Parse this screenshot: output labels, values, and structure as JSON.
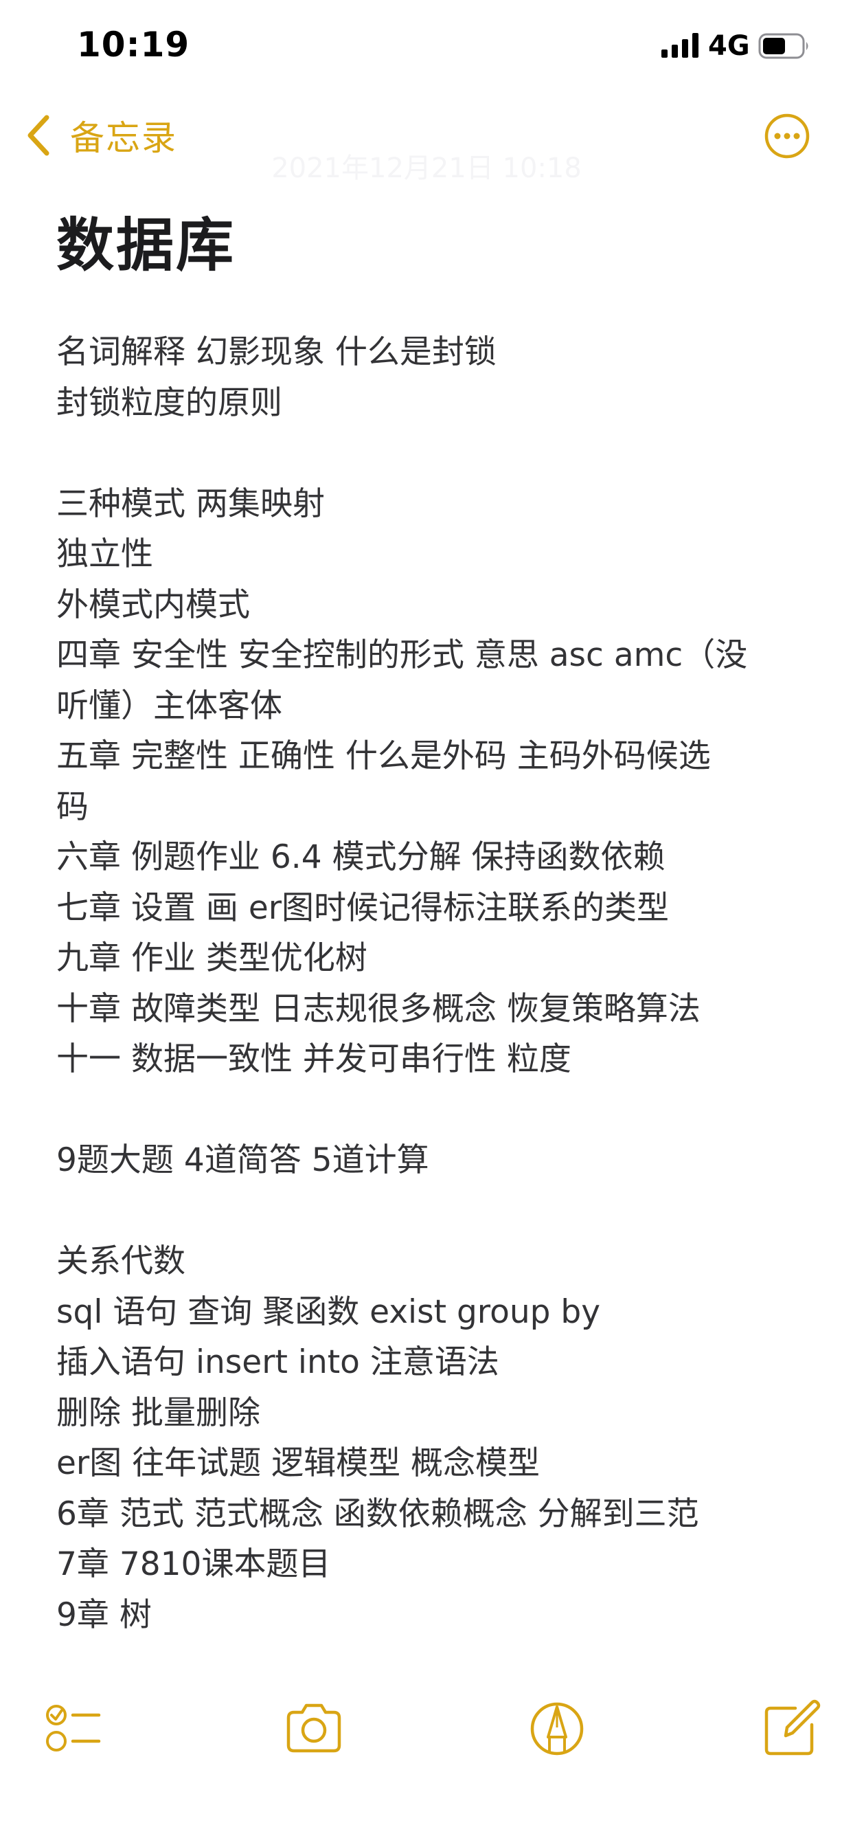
{
  "status_bar": {
    "time": "10:19",
    "network": "4G",
    "signal_icon": "cellular-signal-icon",
    "battery_icon": "battery-icon",
    "battery_level": 0.6
  },
  "nav": {
    "back_label": "备忘录",
    "back_icon": "chevron-left-icon",
    "more_icon": "ellipsis-circle-icon",
    "accent_color": "#d9a514"
  },
  "note": {
    "date": "2021年12月21日 10:18",
    "title": "数据库",
    "lines": [
      "名词解释 幻影现象 什么是封锁",
      "封锁粒度的原则",
      "",
      "三种模式 两集映射",
      "独立性",
      "外模式内模式",
      "四章 安全性 安全控制的形式 意思 asc amc（没",
      "听懂）主体客体",
      "五章 完整性 正确性 什么是外码 主码外码候选",
      "码",
      "六章 例题作业 6.4 模式分解 保持函数依赖",
      "七章 设置 画 er图时候记得标注联系的类型",
      "九章 作业 类型优化树",
      "十章 故障类型 日志规很多概念 恢复策略算法",
      "十一 数据一致性 并发可串行性 粒度",
      "",
      "9题大题 4道简答 5道计算",
      "",
      "关系代数",
      "sql 语句 查询 聚函数 exist group by",
      "插入语句 insert into 注意语法",
      "删除 批量删除",
      "er图 往年试题 逻辑模型 概念模型",
      "6章 范式 范式概念 函数依赖概念 分解到三范",
      "7章 7810课本题目",
      "9章 树"
    ]
  },
  "toolbar": {
    "items": [
      {
        "name": "checklist",
        "icon": "checklist-icon"
      },
      {
        "name": "camera",
        "icon": "camera-icon"
      },
      {
        "name": "markup",
        "icon": "markup-pen-icon"
      },
      {
        "name": "compose",
        "icon": "compose-icon"
      }
    ]
  }
}
